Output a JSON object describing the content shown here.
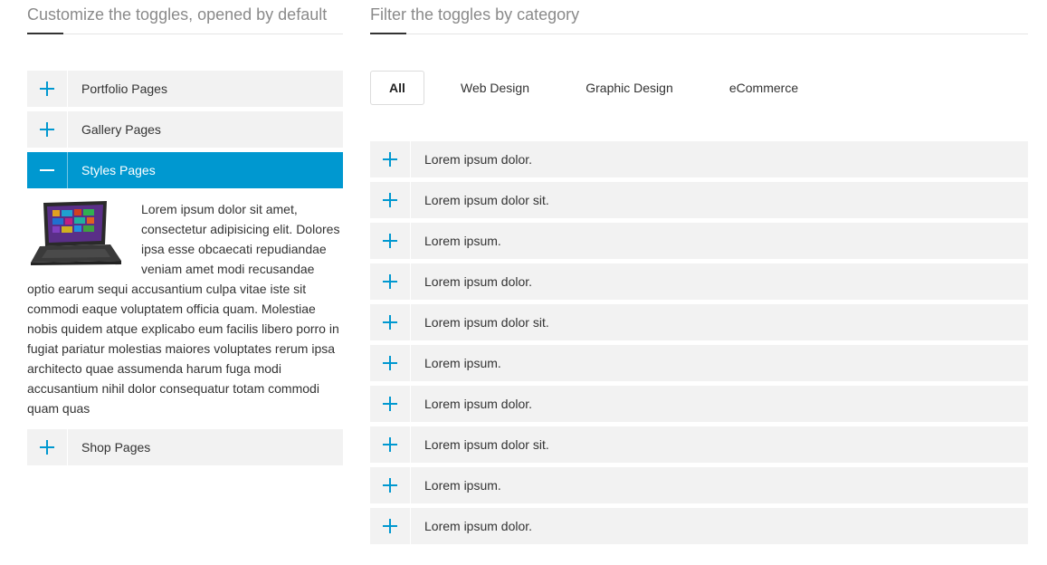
{
  "left": {
    "title": "Customize the toggles, opened by default",
    "toggles": [
      {
        "label": "Portfolio Pages"
      },
      {
        "label": "Gallery Pages"
      },
      {
        "label": "Styles Pages",
        "content": "Lorem ipsum dolor sit amet, consectetur adipisicing elit. Dolores ipsa esse obcaecati repudiandae veniam amet modi recusandae optio earum sequi accusantium culpa vitae iste sit commodi eaque voluptatem officia quam. Molestiae nobis quidem atque explicabo eum facilis libero porro in fugiat pariatur molestias maiores voluptates rerum ipsa architecto quae assumenda harum fuga modi accusantium nihil dolor consequatur totam commodi quam quas"
      },
      {
        "label": "Shop Pages"
      }
    ]
  },
  "right": {
    "title": "Filter the toggles by category",
    "filters": [
      {
        "label": "All"
      },
      {
        "label": "Web Design"
      },
      {
        "label": "Graphic Design"
      },
      {
        "label": "eCommerce"
      }
    ],
    "toggles": [
      {
        "label": "Lorem ipsum dolor."
      },
      {
        "label": "Lorem ipsum dolor sit."
      },
      {
        "label": "Lorem ipsum."
      },
      {
        "label": "Lorem ipsum dolor."
      },
      {
        "label": "Lorem ipsum dolor sit."
      },
      {
        "label": "Lorem ipsum."
      },
      {
        "label": "Lorem ipsum dolor."
      },
      {
        "label": "Lorem ipsum dolor sit."
      },
      {
        "label": "Lorem ipsum."
      },
      {
        "label": "Lorem ipsum dolor."
      }
    ]
  },
  "colors": {
    "accent": "#0098d0",
    "toggle_bg": "#f2f2f2",
    "title": "#8a8a8a"
  },
  "icons": {
    "collapsed": "plus-icon",
    "expanded": "minus-icon"
  }
}
